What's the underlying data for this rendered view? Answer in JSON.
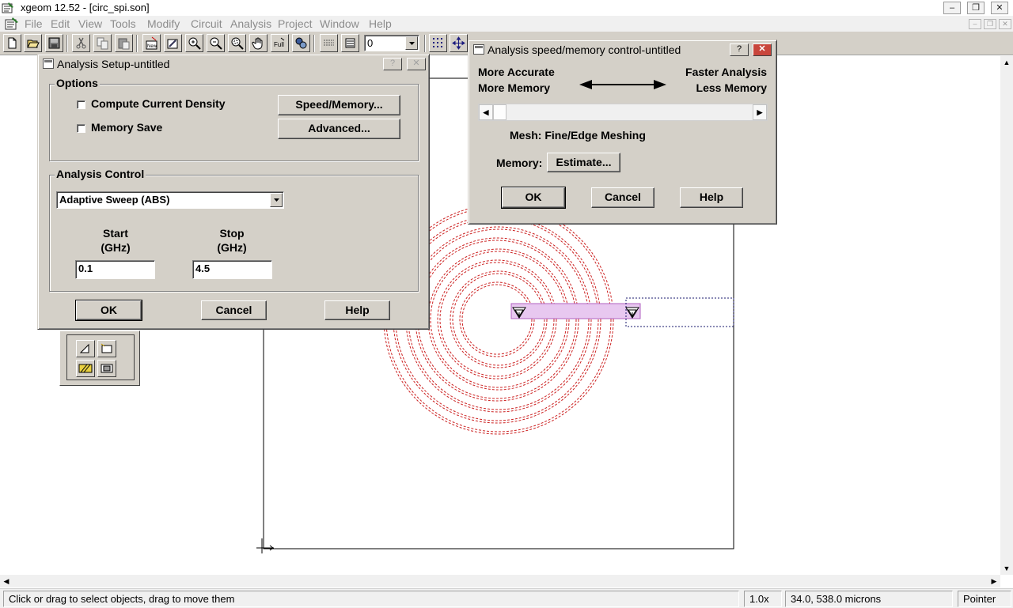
{
  "window": {
    "title": "xgeom 12.52 - [circ_spi.son]",
    "controls": [
      "minimize",
      "restore",
      "close"
    ]
  },
  "menubar": {
    "items": [
      "File",
      "Edit",
      "View",
      "Tools",
      "Modify",
      "Circuit",
      "Analysis",
      "Project",
      "Window",
      "Help"
    ],
    "text_color": "#8c8c8c"
  },
  "toolbar": {
    "level_value": "0",
    "icons": [
      "new-file-icon",
      "open-folder-icon",
      "save-icon",
      "cut-icon",
      "copy-icon",
      "paste-icon",
      "new-metal-icon",
      "edit-layer-icon",
      "zoom-in-icon",
      "zoom-out-icon",
      "zoom-box-icon",
      "pan-hand-icon",
      "zoom-full-icon",
      "port-icon",
      "dielectric-icon",
      "layers-icon",
      "grid-icon",
      "move-icon"
    ]
  },
  "analysis_setup": {
    "title": "Analysis Setup-untitled",
    "title_buttons": [
      "?",
      "✕"
    ],
    "options_label": "Options",
    "compute_current_density_label": "Compute Current Density",
    "compute_current_density_checked": false,
    "memory_save_label": "Memory Save",
    "memory_save_checked": false,
    "speed_memory_button": "Speed/Memory...",
    "advanced_button": "Advanced...",
    "analysis_control_label": "Analysis Control",
    "sweep_type": "Adaptive Sweep (ABS)",
    "start_label": "Start",
    "start_unit": "(GHz)",
    "start_value": "0.1",
    "stop_label": "Stop",
    "stop_unit": "(GHz)",
    "stop_value": "4.5",
    "ok_button": "OK",
    "cancel_button": "Cancel",
    "help_button": "Help"
  },
  "speed_memory": {
    "title": "Analysis speed/memory control-untitled",
    "title_buttons": [
      "?",
      "✕"
    ],
    "left_top": "More Accurate",
    "left_bottom": "More Memory",
    "right_top": "Faster Analysis",
    "right_bottom": "Less Memory",
    "slider_level": 0,
    "mesh_text": "Mesh: Fine/Edge Meshing",
    "memory_label": "Memory:",
    "estimate_button": "Estimate...",
    "ok_button": "OK",
    "cancel_button": "Cancel",
    "help_button": "Help"
  },
  "status": {
    "message": "Click or drag to select objects, drag to move them",
    "zoom": "1.0x",
    "coordinates": "34.0, 538.0 microns",
    "mode": "Pointer"
  },
  "colors": {
    "dialog_face": "#d4d0c8",
    "spiral": "#cc2222",
    "metal_fill": "#e8c8f0",
    "port_box": "#1a1a6e"
  }
}
